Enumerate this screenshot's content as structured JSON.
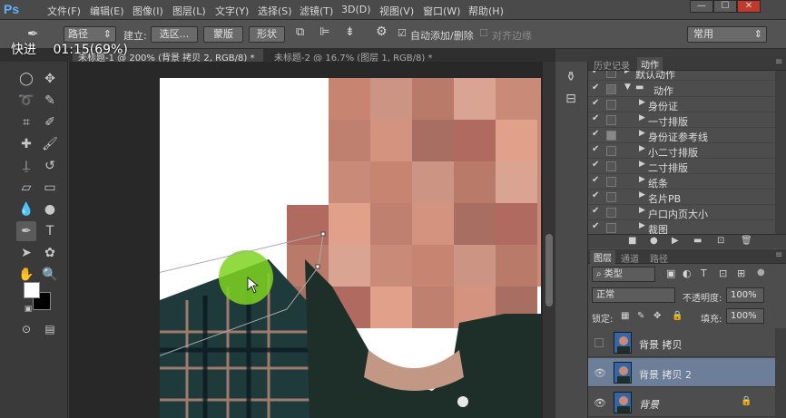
{
  "app": {
    "logo": "Ps"
  },
  "menu": [
    "文件(F)",
    "编辑(E)",
    "图像(I)",
    "图层(L)",
    "文字(Y)",
    "选择(S)",
    "滤镜(T)",
    "3D(D)",
    "视图(V)",
    "窗口(W)",
    "帮助(H)"
  ],
  "window_controls": {
    "minimize": "—",
    "maximize": "☐",
    "close": "✕"
  },
  "options_bar": {
    "mode_value": "路径",
    "build_label": "建立:",
    "selection_btn": "选区...",
    "mask_btn": "蒙版",
    "shape_btn": "形状",
    "auto_add_label": "自动添加/删除",
    "align_edges_label": "对齐边缘",
    "workspace_value": "常用"
  },
  "progress_overlay": {
    "label": "快进",
    "time": "01:15(69%)"
  },
  "document_tabs": [
    {
      "title": "未标题-1 @ 200% (背景 拷贝 2, RGB/8) *",
      "active": true
    },
    {
      "title": "未标题-2 @ 16.7% (图层 1, RGB/8) *",
      "active": false
    }
  ],
  "history_panel": {
    "tabs": [
      "历史记录",
      "动作"
    ],
    "active_tab": "动作",
    "rows": [
      {
        "label": "默认动作",
        "expanded": false,
        "folder": true,
        "top_cut": true
      },
      {
        "label": "动作",
        "expanded": true,
        "folder": true
      },
      {
        "label": "身份证"
      },
      {
        "label": "一寸排版"
      },
      {
        "label": "身份证参考线",
        "has_box": true
      },
      {
        "label": "小二寸排版"
      },
      {
        "label": "二寸排版"
      },
      {
        "label": "纸条"
      },
      {
        "label": "名片PB"
      },
      {
        "label": "户口内页大小"
      },
      {
        "label": "裁图"
      }
    ]
  },
  "layers_panel": {
    "tabs": [
      "图层",
      "通道",
      "路径"
    ],
    "active_tab": "图层",
    "filter_kind": "类型",
    "blend_mode": "正常",
    "opacity_label": "不透明度:",
    "opacity_value": "100%",
    "lock_label": "锁定:",
    "fill_label": "填充:",
    "fill_value": "100%",
    "layers": [
      {
        "name": "背景 拷贝",
        "visible": false,
        "selected": false,
        "locked": false
      },
      {
        "name": "背景 拷贝 2",
        "visible": true,
        "selected": true,
        "locked": false
      },
      {
        "name": "背景",
        "visible": true,
        "selected": false,
        "locked": true
      }
    ]
  },
  "colors": {
    "foreground": "#ffffff",
    "background": "#000000",
    "selected_layer": "#6d7e99",
    "highlight_brush": "#7ed321"
  }
}
